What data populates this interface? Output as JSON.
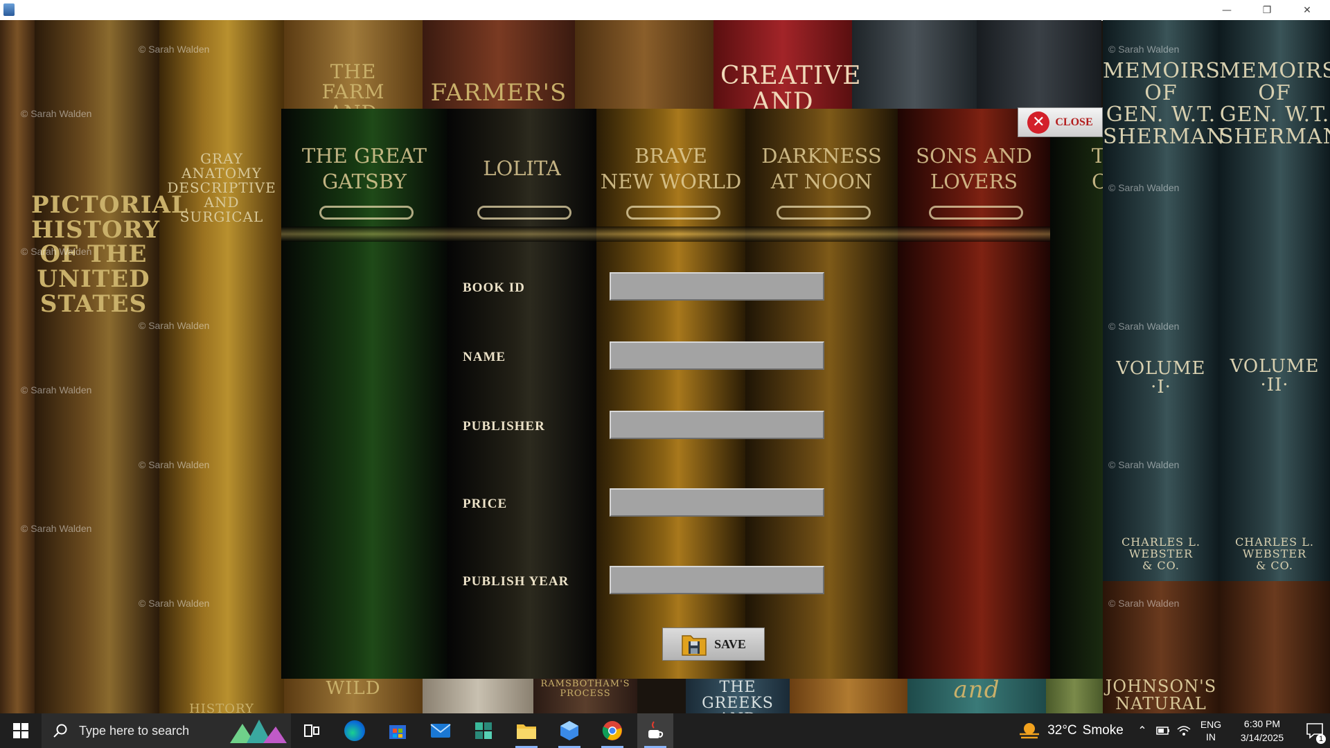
{
  "window": {
    "controls": {
      "minimize": "—",
      "restore": "❐",
      "close": "✕"
    }
  },
  "background": {
    "watermark": "© Sarah Walden",
    "spines": [
      {
        "text": "THE FARM\nAND"
      },
      {
        "text": "FARMER'S"
      },
      {
        "text": "CREATIVE\nAND"
      },
      {
        "text": "MEMOIRS\nOF\nGEN. W.T.\nSHERMAN"
      },
      {
        "text": "MEMOIRS\nOF\nGEN. W.T.\nSHERMAN"
      },
      {
        "text": "VOLUME\n·I·"
      },
      {
        "text": "VOLUME\n·II·"
      },
      {
        "text": "CHARLES L. WEBSTER\n& CO."
      },
      {
        "text": "CHARLES L. WEBSTER\n& CO."
      },
      {
        "text": "PICTORIAL\nHISTORY\nOF THE\nUNITED STATES"
      },
      {
        "text": "GRAY\nANATOMY\nDESCRIPTIVE\nAND\nSURGICAL"
      },
      {
        "text": "THE GREEKS\nAND"
      },
      {
        "text": "RAMSBOTHAM'S\nPROCESS"
      },
      {
        "text": "JOHNSON'S\nNATURAL"
      },
      {
        "text": "HISTORY"
      },
      {
        "text": "WILD"
      },
      {
        "text": "and"
      }
    ]
  },
  "form": {
    "book_titles": [
      "THE GREAT\nGATSBY",
      "LOLITA",
      "BRAVE\nNEW WORLD",
      "DARKNESS\nAT NOON",
      "SONS AND\nLOVERS",
      "TI\nC"
    ],
    "fields": [
      {
        "label": "BOOK ID",
        "value": ""
      },
      {
        "label": "NAME",
        "value": ""
      },
      {
        "label": "PUBLISHER",
        "value": ""
      },
      {
        "label": "PRICE",
        "value": ""
      },
      {
        "label": "PUBLISH YEAR",
        "value": ""
      }
    ],
    "save_label": "SAVE",
    "close_label": "CLOSE"
  },
  "taskbar": {
    "search_placeholder": "Type here to search",
    "apps": [
      "task-view",
      "edge",
      "microsoft-store",
      "mail",
      "app-grid",
      "file-explorer",
      "3d-cube-app",
      "chrome",
      "java"
    ],
    "weather": {
      "temp": "32°C",
      "condition": "Smoke"
    },
    "language": {
      "line1": "ENG",
      "line2": "IN"
    },
    "clock": {
      "time": "6:30 PM",
      "date": "3/14/2025"
    },
    "notification_count": "1"
  }
}
